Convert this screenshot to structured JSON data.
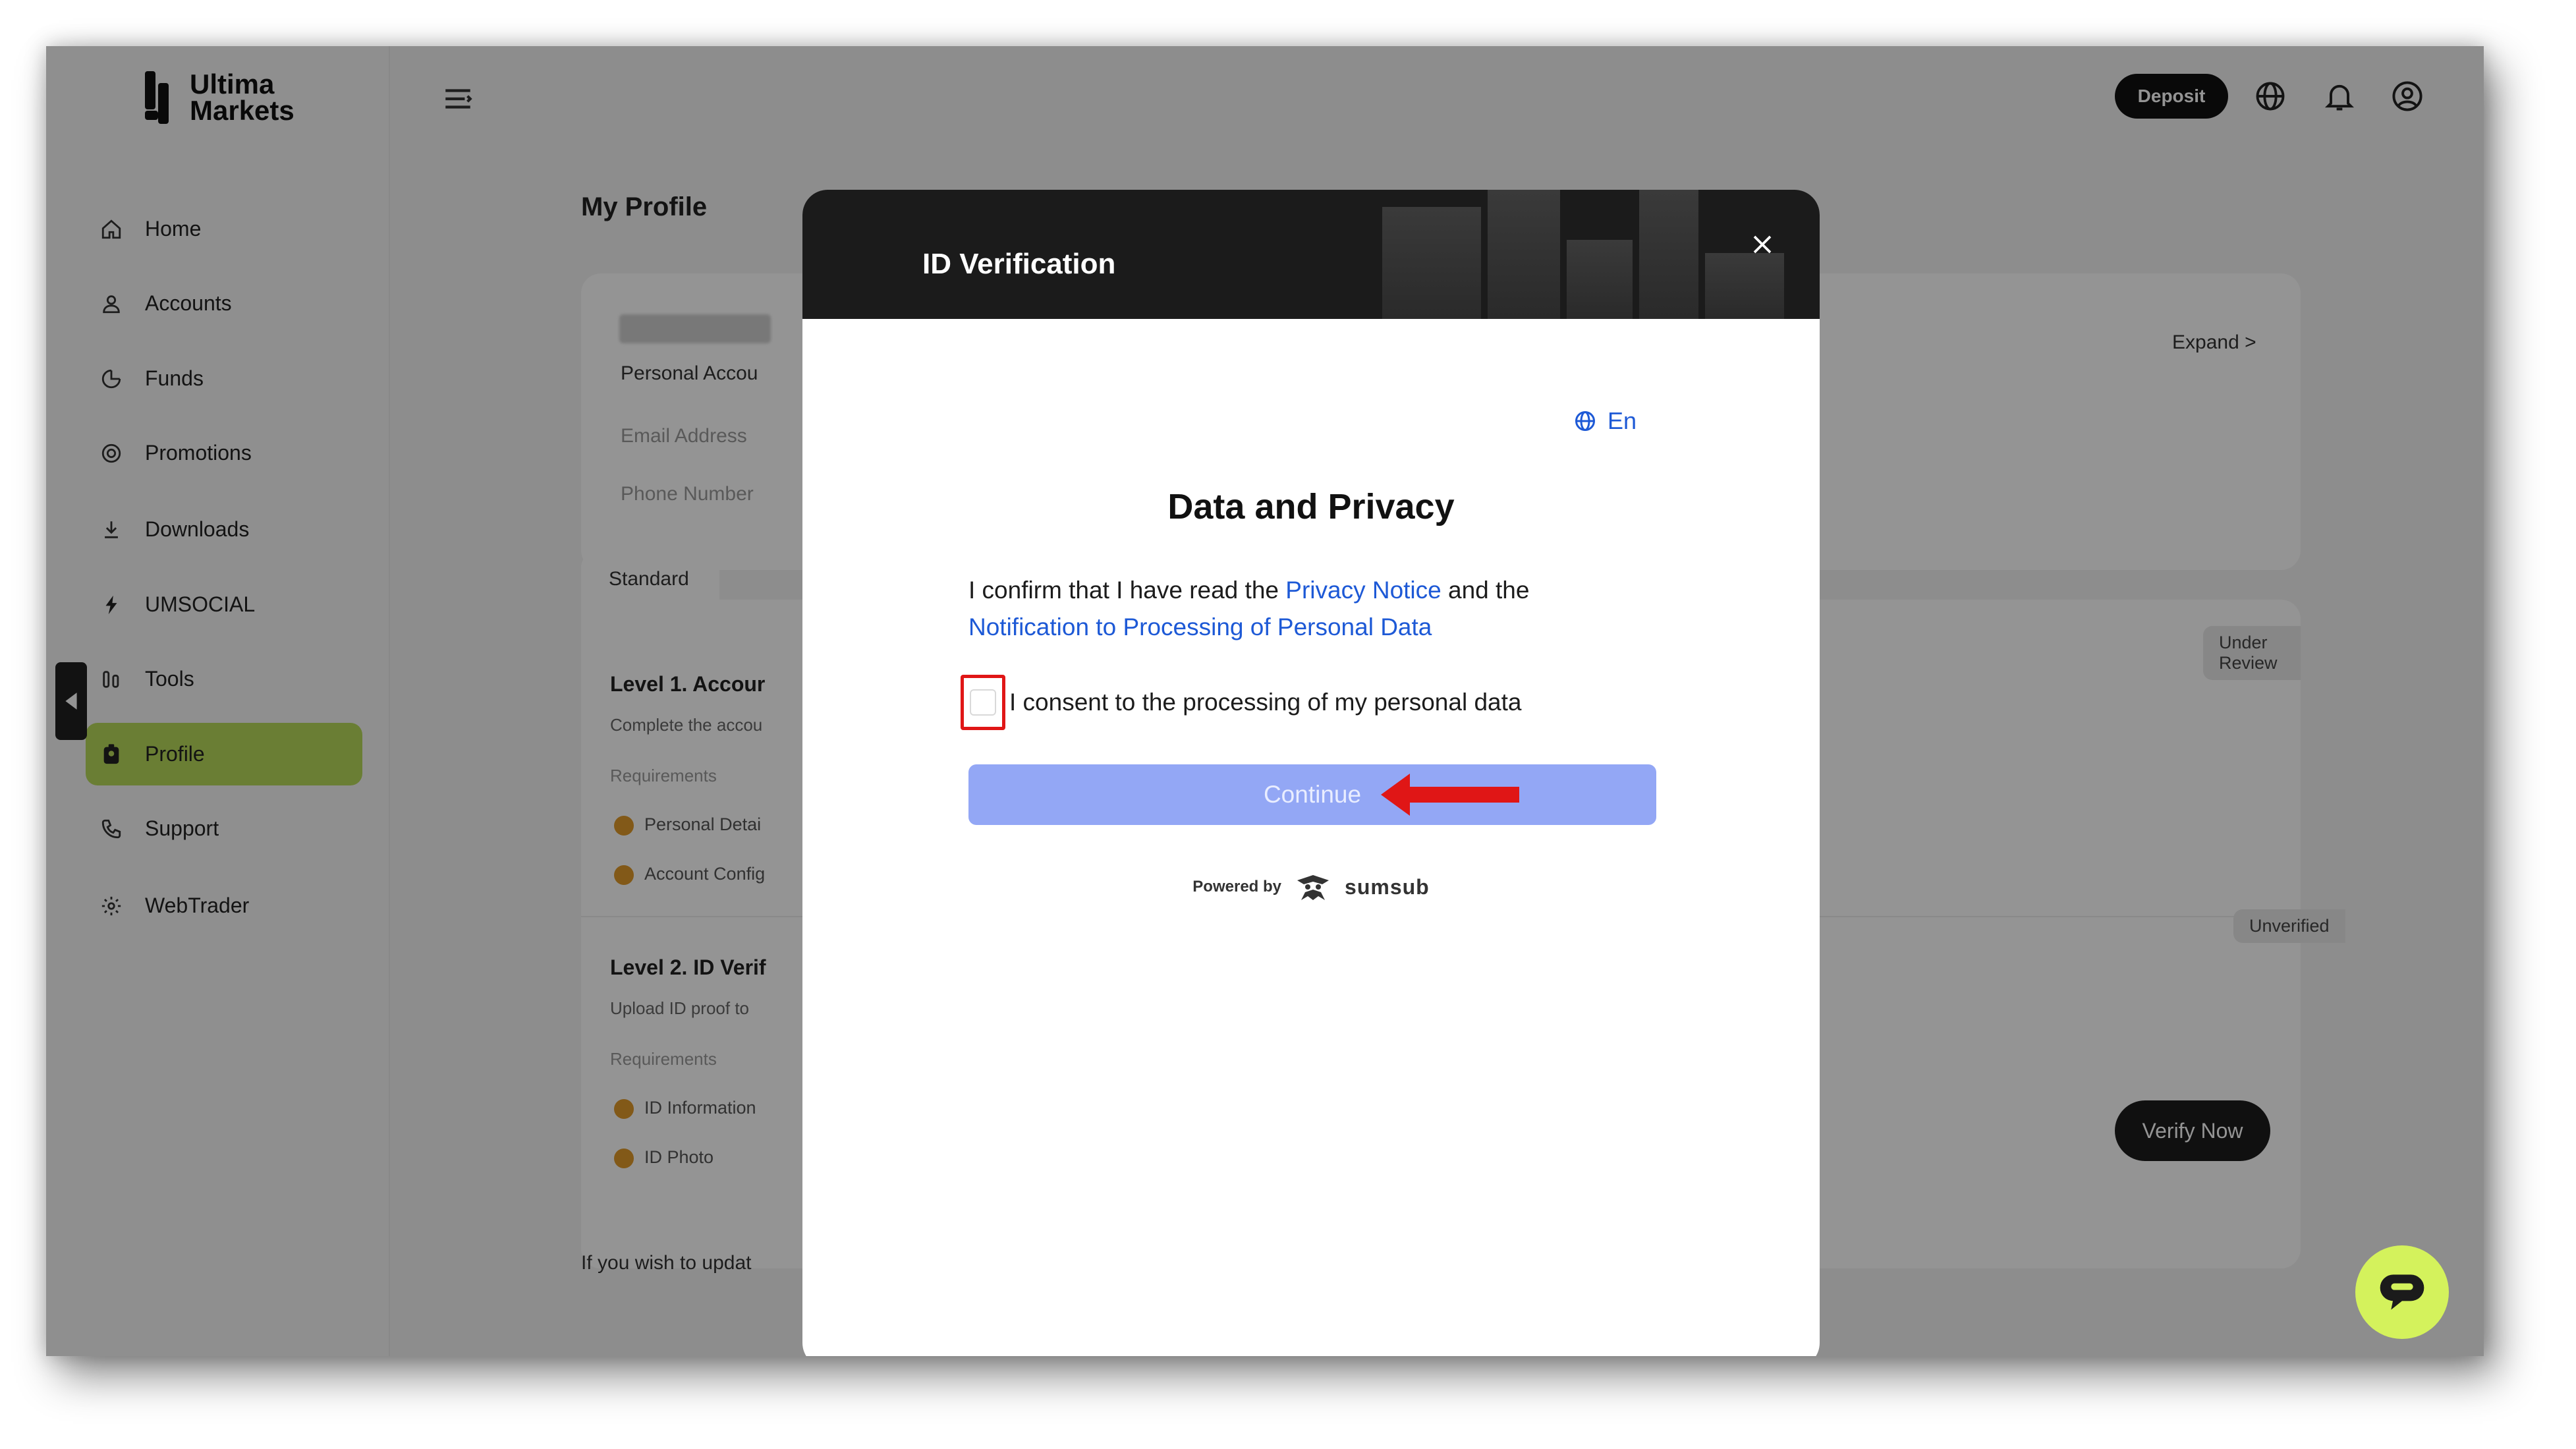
{
  "brand": {
    "line1": "Ultima",
    "line2": "Markets"
  },
  "sidebar": {
    "items": [
      {
        "label": "Home",
        "icon": "home-icon"
      },
      {
        "label": "Accounts",
        "icon": "user-icon"
      },
      {
        "label": "Funds",
        "icon": "wallet-icon"
      },
      {
        "label": "Promotions",
        "icon": "target-icon"
      },
      {
        "label": "Downloads",
        "icon": "download-icon"
      },
      {
        "label": "UMSOCIAL",
        "icon": "umsocial-icon"
      },
      {
        "label": "Tools",
        "icon": "tools-icon"
      },
      {
        "label": "Profile",
        "icon": "profile-icon",
        "active": true
      },
      {
        "label": "Support",
        "icon": "phone-icon"
      },
      {
        "label": "WebTrader",
        "icon": "gear-icon"
      }
    ]
  },
  "topbar": {
    "deposit_label": "Deposit"
  },
  "profile": {
    "page_title": "My Profile",
    "personal_account": "Personal Accou",
    "email_label": "Email Address",
    "phone_label": "Phone Number",
    "expand_label": "Expand >",
    "tab_standard": "Standard",
    "level1": {
      "title": "Level 1. Accour",
      "desc": "Complete the accou",
      "requirements_label": "Requirements",
      "req1": "Personal Detai",
      "req2": "Account Config",
      "status": "Under Review"
    },
    "level2": {
      "title": "Level 2. ID Verif",
      "desc": "Upload ID proof to",
      "requirements_label": "Requirements",
      "req1": "ID Information",
      "req2": "ID Photo",
      "status": "Unverified",
      "verify_label": "Verify Now"
    },
    "footer_note": "If you wish to updat"
  },
  "modal": {
    "title": "ID Verification",
    "language": "En",
    "heading": "Data and Privacy",
    "confirm_prefix": "I confirm that I have read the",
    "privacy_link": "Privacy Notice",
    "confirm_mid": "and the",
    "processing_link": "Notification to Processing of Personal Data",
    "consent_text": "I consent to the processing of my personal data",
    "continue_label": "Continue",
    "powered_by": "Powered by",
    "provider": "sumsub"
  },
  "colors": {
    "accent": "#b7d95a",
    "link": "#1d59d6",
    "button_disabled": "#93a7f5",
    "highlight": "#e01616",
    "chat": "#d4f25c"
  }
}
